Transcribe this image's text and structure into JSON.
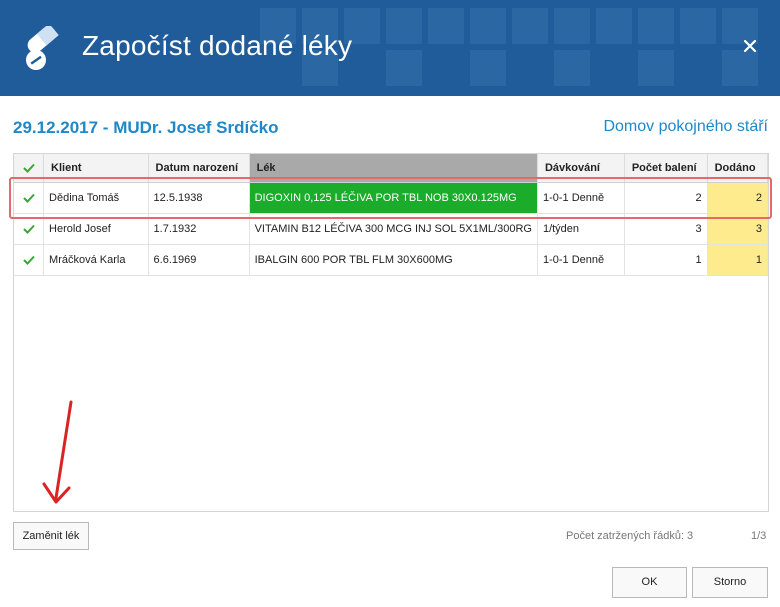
{
  "dialog": {
    "title": "Započíst dodané léky",
    "close_label": "×"
  },
  "subheader": {
    "date_doctor": "29.12.2017 - MUDr. Josef Srdíčko",
    "facility": "Domov pokojného stáří"
  },
  "grid": {
    "columns": [
      "",
      "Klient",
      "Datum narození",
      "Lék",
      "Dávkování",
      "Počet balení",
      "Dodáno"
    ],
    "rows": [
      {
        "checked": true,
        "client": "Dědina Tomáš",
        "dob": "12.5.1938",
        "drug": "DIGOXIN 0,125 LÉČIVA POR TBL NOB 30X0.125MG",
        "dosage": "1-0-1 Denně",
        "packs": "2",
        "delivered": "2",
        "selected": true
      },
      {
        "checked": true,
        "client": "Herold Josef",
        "dob": "1.7.1932",
        "drug": "VITAMIN B12 LÉČIVA 300 MCG INJ SOL 5X1ML/300RG",
        "dosage": "1/týden",
        "packs": "3",
        "delivered": "3",
        "selected": false
      },
      {
        "checked": true,
        "client": "Mráčková Karla",
        "dob": "6.6.1969",
        "drug": "IBALGIN 600 POR TBL FLM 30X600MG",
        "dosage": "1-0-1 Denně",
        "packs": "1",
        "delivered": "1",
        "selected": false
      }
    ]
  },
  "footer": {
    "replace_label": "Zaměnit lék",
    "row_count": "Počet zatržených řádků: 3",
    "page": "1/3",
    "ok_label": "OK",
    "cancel_label": "Storno"
  },
  "colors": {
    "header_bg": "#1f5c99",
    "accent_text": "#1e88c8",
    "selected_drug_bg": "#1aac2a",
    "delivered_bg": "#fdeb8d",
    "highlight_border": "#e26a6a",
    "check": "#3aa635"
  },
  "icons": [
    "pills-icon",
    "close-icon",
    "check-icon",
    "arrow-annotation"
  ]
}
